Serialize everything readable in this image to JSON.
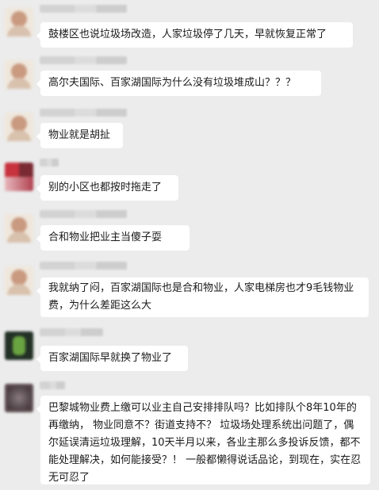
{
  "messages": [
    {
      "text": "鼓楼区也说垃圾场改造，人家垃圾停了几天，早就恢复正常了"
    },
    {
      "text": "高尔夫国际、百家湖国际为什么没有垃圾堆成山？？？"
    },
    {
      "text": "物业就是胡扯"
    },
    {
      "text": "别的小区也都按时拖走了"
    },
    {
      "text": "合和物业把业主当傻子耍"
    },
    {
      "text": "我就纳了闷，百家湖国际也是合和物业，人家电梯房也才9毛钱物业费，为什么差距这么大"
    },
    {
      "text": "百家湖国际早就换了物业了"
    },
    {
      "text": "巴黎城物业费上缴可以业主自己安排排队吗？比如排队个8年10年的再缴纳，  物业同意不？街道支持不？  垃圾场处理系统出问题了，偶尔延误清运垃圾理解，10天半月以来，各业主那么多投诉反馈，都不能处理解决，如何能接受？！ 一般都懒得说话品论，到现在，实在忍无可忍了"
    }
  ]
}
